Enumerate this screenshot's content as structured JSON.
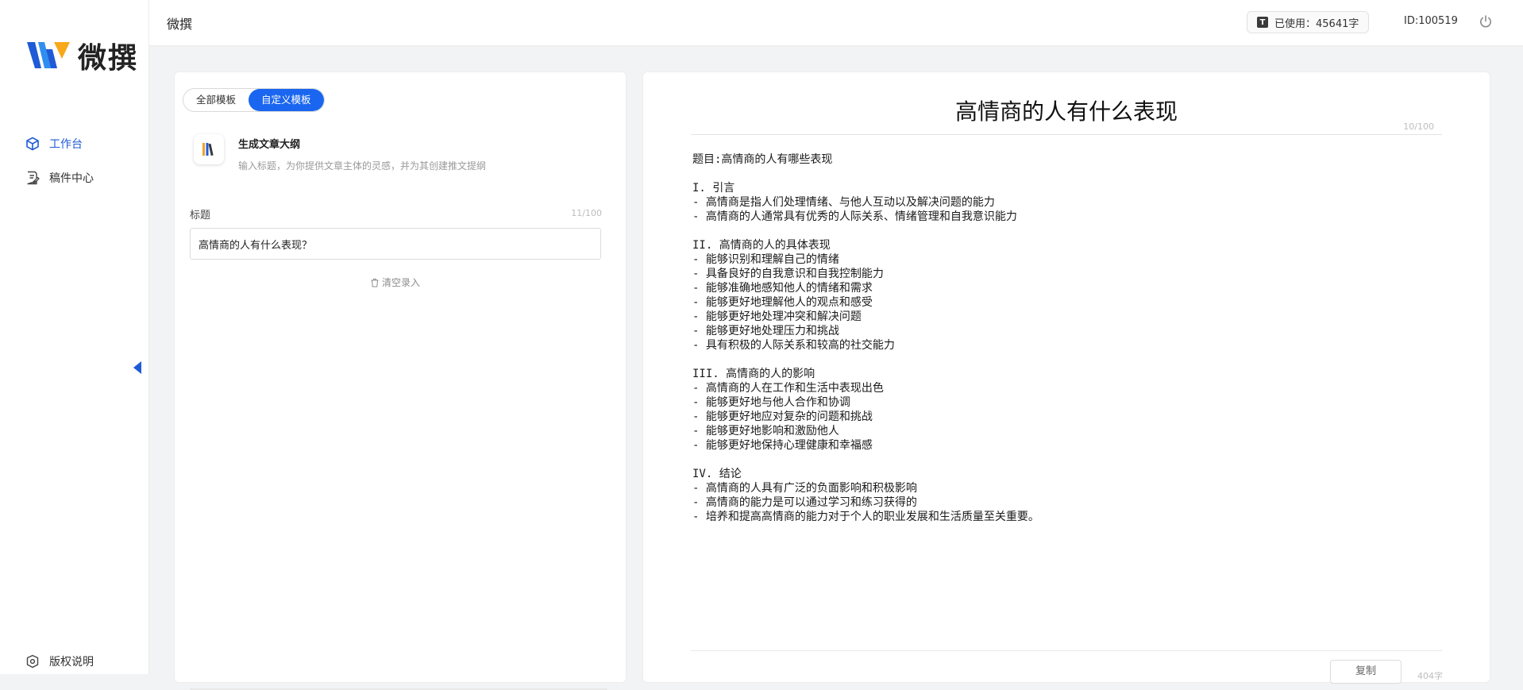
{
  "brand": {
    "name": "微撰"
  },
  "sidebar": {
    "items": [
      {
        "label": "工作台",
        "icon": "cube-icon",
        "active": true
      },
      {
        "label": "稿件中心",
        "icon": "document-edit-icon",
        "active": false
      }
    ],
    "footer": {
      "label": "版权说明",
      "icon": "shield-icon"
    }
  },
  "header": {
    "title": "微撰",
    "usage": "已使用：45641字",
    "user_id": "ID:100519"
  },
  "left": {
    "tabs": [
      {
        "label": "全部模板",
        "active": false
      },
      {
        "label": "自定义模板",
        "active": true
      }
    ],
    "template": {
      "name": "生成文章大纲",
      "desc": "输入标题，为你提供文章主体的灵感，并为其创建推文提纲"
    },
    "field": {
      "label": "标题",
      "count": "11/100",
      "value": "高情商的人有什么表现？"
    },
    "clear_label": "清空录入"
  },
  "right": {
    "title": "高情商的人有什么表现",
    "title_count": "10/100",
    "lines": [
      "题目:高情商的人有哪些表现",
      "",
      "I. 引言",
      "- 高情商是指人们处理情绪、与他人互动以及解决问题的能力",
      "- 高情商的人通常具有优秀的人际关系、情绪管理和自我意识能力",
      "",
      "II. 高情商的人的具体表现",
      "- 能够识别和理解自己的情绪",
      "- 具备良好的自我意识和自我控制能力",
      "- 能够准确地感知他人的情绪和需求",
      "- 能够更好地理解他人的观点和感受",
      "- 能够更好地处理冲突和解决问题",
      "- 能够更好地处理压力和挑战",
      "- 具有积极的人际关系和较高的社交能力",
      "",
      "III. 高情商的人的影响",
      "- 高情商的人在工作和生活中表现出色",
      "- 能够更好地与他人合作和协调",
      "- 能够更好地应对复杂的问题和挑战",
      "- 能够更好地影响和激励他人",
      "- 能够更好地保持心理健康和幸福感",
      "",
      "IV. 结论",
      "- 高情商的人具有广泛的负面影响和积极影响",
      "- 高情商的能力是可以通过学习和练习获得的",
      "- 培养和提高高情商的能力对于个人的职业发展和生活质量至关重要。"
    ],
    "copy_label": "复制",
    "word_count": "404字"
  },
  "colors": {
    "accent": "#1a66f0",
    "nav_active": "#1f5bd6"
  }
}
